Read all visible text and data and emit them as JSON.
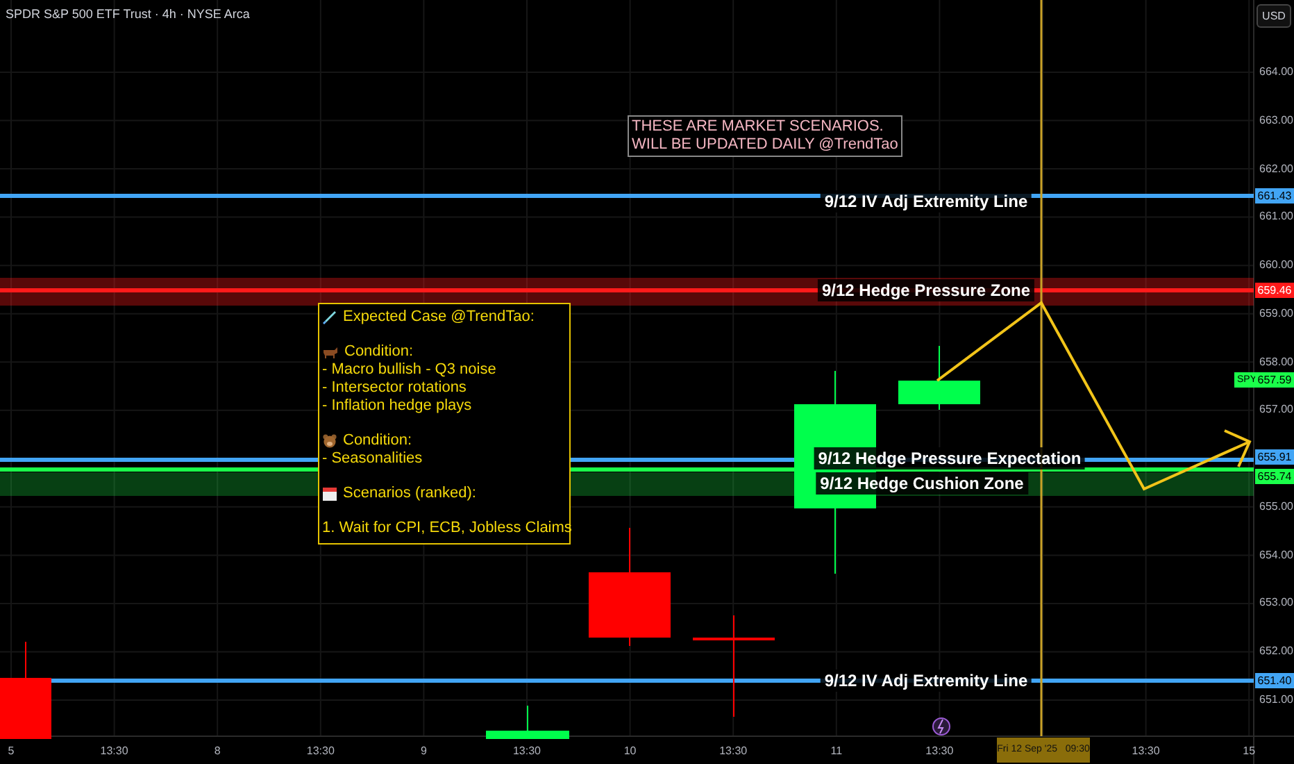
{
  "symbol_title": "SPDR S&P 500 ETF Trust · 4h · NYSE Arca",
  "currency_button": "USD",
  "price_axis": [
    "664.00",
    "663.00",
    "662.00",
    "661.00",
    "660.00",
    "659.00",
    "658.00",
    "657.00",
    "655.00",
    "654.00",
    "653.00",
    "652.00",
    "651.00"
  ],
  "time_axis": [
    "5",
    "13:30",
    "8",
    "13:30",
    "9",
    "13:30",
    "10",
    "13:30",
    "11",
    "13:30",
    "13:30",
    "15"
  ],
  "crosshair_time": "Fri 12 Sep '25   09:30",
  "notice": [
    "THESE ARE MARKET SCENARIOS.",
    "WILL BE UPDATED DAILY @TrendTao"
  ],
  "levels": [
    {
      "kind": "line",
      "label": "9/12 IV Adj Extremity Line",
      "price_tag": "661.43",
      "color": "#42a5f5"
    },
    {
      "kind": "zone",
      "label": "9/12 Hedge Pressure Zone",
      "price_tag": "659.46",
      "color": "#ff1a1a"
    },
    {
      "kind": "line",
      "label": "9/12 Hedge Pressure Expectation",
      "price_tag": "655.91",
      "color": "#42a5f5"
    },
    {
      "kind": "zone",
      "label": "9/12 Hedge Cushion Zone",
      "price_tag": "655.74",
      "color": "#1aff4a"
    },
    {
      "kind": "line",
      "label": "9/12 IV Adj Extremity Line",
      "price_tag": "651.40",
      "color": "#42a5f5"
    }
  ],
  "last_price": {
    "symbol": "SPY",
    "price": "657.59"
  },
  "note": {
    "sections": [
      {
        "title": "Expected Case @TrendTao:"
      },
      {
        "title": "Condition:",
        "items": [
          "- Macro bullish - Q3 noise",
          "- Intersector rotations",
          "- Inflation hedge plays"
        ]
      },
      {
        "title": "Condition:",
        "items": [
          "- Seasonalities"
        ]
      },
      {
        "title": "Scenarios (ranked):",
        "items": [
          "1. Wait for CPI, ECB, Jobless Claims"
        ]
      }
    ]
  }
}
